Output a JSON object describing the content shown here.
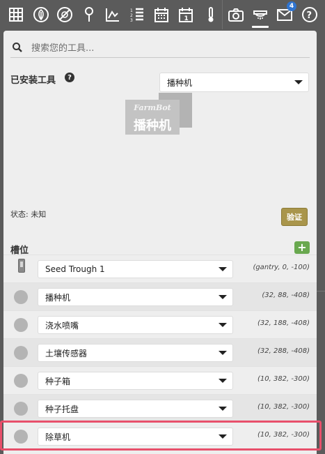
{
  "nav": {
    "items": [
      {
        "name": "grid-icon"
      },
      {
        "name": "leaf-icon"
      },
      {
        "name": "no-sign-icon"
      },
      {
        "name": "location-pin-icon"
      },
      {
        "name": "chart-icon"
      },
      {
        "name": "numbered-list-icon"
      },
      {
        "name": "calendar-icon"
      },
      {
        "name": "calendar-day-icon"
      },
      {
        "name": "thermometer-icon"
      },
      {
        "name": "camera-icon"
      },
      {
        "name": "tools-icon",
        "active": true
      },
      {
        "name": "mail-icon",
        "badge": "4"
      },
      {
        "name": "help-icon"
      }
    ],
    "active_indicator_color": "#ffffff",
    "badge_color": "#2f74d0",
    "arrow_color": "#e8506b"
  },
  "search": {
    "placeholder": "搜索您的工具..."
  },
  "installed_tool": {
    "title": "已安装工具",
    "help": "?",
    "selected": "播种机",
    "logo_brand": "FarmBot",
    "logo_text": "播种机",
    "status": "状态: 未知",
    "verify_label": "验证"
  },
  "slots": {
    "title": "槽位",
    "add_label": "+",
    "rows": [
      {
        "icon": "seed-trough-icon",
        "tool": "Seed Trough 1",
        "coords": "(gantry, 0, -100)"
      },
      {
        "icon": "tool-circle-icon",
        "tool": "播种机",
        "coords": "(32, 88, -408)"
      },
      {
        "icon": "tool-circle-icon",
        "tool": "浇水喷嘴",
        "coords": "(32, 188, -408)"
      },
      {
        "icon": "tool-circle-icon",
        "tool": "土壤传感器",
        "coords": "(32, 288, -408)"
      },
      {
        "icon": "tool-circle-icon",
        "tool": "种子箱",
        "coords": "(10, 382, -300)"
      },
      {
        "icon": "tool-circle-icon",
        "tool": "种子托盘",
        "coords": "(10, 382, -300)"
      },
      {
        "icon": "tool-circle-icon",
        "tool": "除草机",
        "coords": "(10, 382, -300)"
      }
    ],
    "highlight_color": "#e8506b",
    "verify_color": "#a9954b",
    "add_color": "#69a84f"
  }
}
